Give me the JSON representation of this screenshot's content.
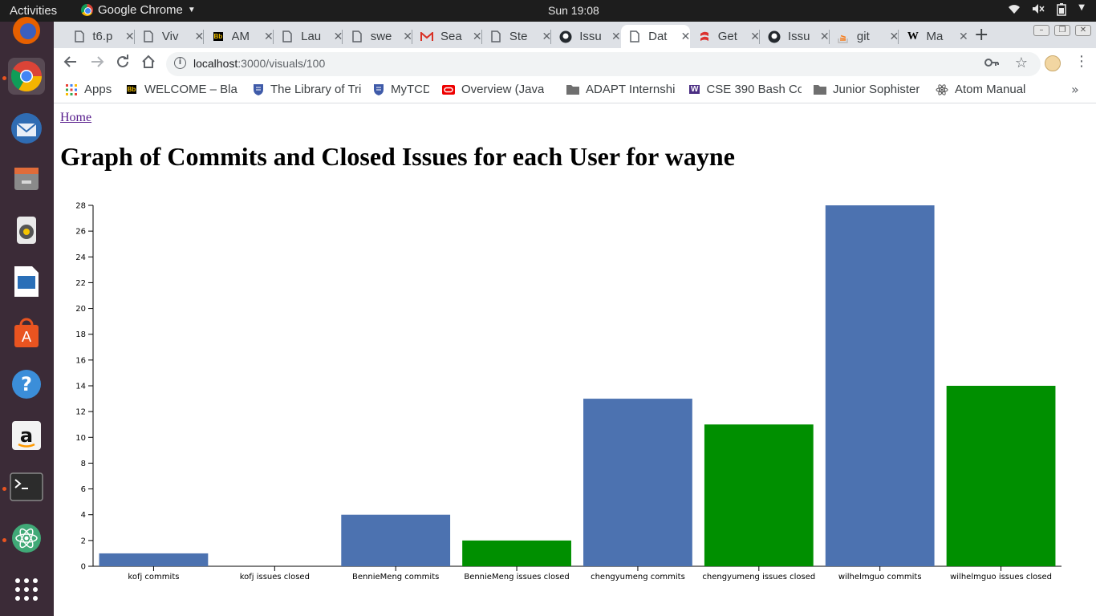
{
  "system_bar": {
    "activities": "Activities",
    "app_name": "Google Chrome",
    "clock": "Sun 19:08"
  },
  "launcher": {
    "apps": [
      "firefox-icon",
      "chrome-icon",
      "thunderbird-icon",
      "files-icon",
      "rhythmbox-icon",
      "libreoffice-writer-icon",
      "software-center-icon",
      "help-icon",
      "amazon-icon",
      "terminal-icon",
      "atom-icon",
      "show-apps-icon"
    ]
  },
  "tabs": [
    {
      "label": "t6.p",
      "icon": "page"
    },
    {
      "label": "Viv",
      "icon": "page"
    },
    {
      "label": "AM",
      "icon": "blackboard"
    },
    {
      "label": "Lau",
      "icon": "page"
    },
    {
      "label": "swe",
      "icon": "page"
    },
    {
      "label": "Sea",
      "icon": "gmail"
    },
    {
      "label": "Ste",
      "icon": "page"
    },
    {
      "label": "Issu",
      "icon": "github"
    },
    {
      "label": "Dat",
      "icon": "page",
      "active": true
    },
    {
      "label": "Get",
      "icon": "scala"
    },
    {
      "label": "Issu",
      "icon": "github"
    },
    {
      "label": "git",
      "icon": "stackoverflow"
    },
    {
      "label": "Ma",
      "icon": "wikipedia"
    }
  ],
  "address_bar": {
    "host": "localhost",
    "path": ":3000/visuals/100"
  },
  "bookmarks": [
    {
      "label": "Apps",
      "icon": "apps"
    },
    {
      "label": "WELCOME – Bla",
      "icon": "blackboard"
    },
    {
      "label": "The Library of Tri",
      "icon": "shield"
    },
    {
      "label": "MyTCD",
      "icon": "shield"
    },
    {
      "label": "Overview (Java",
      "icon": "oracle"
    },
    {
      "label": "ADAPT Internshi",
      "icon": "folder"
    },
    {
      "label": "CSE 390 Bash Co",
      "icon": "washington"
    },
    {
      "label": "Junior Sophister",
      "icon": "folder"
    },
    {
      "label": "Atom Manual",
      "icon": "atom"
    }
  ],
  "page": {
    "home_link": "Home",
    "title": "Graph of Commits and Closed Issues for each User for wayne"
  },
  "colors": {
    "commits": "#4c72b0",
    "issues": "#008f00"
  },
  "chart_data": {
    "type": "bar",
    "categories": [
      "kofj commits",
      "kofj issues closed",
      "BennieMeng commits",
      "BennieMeng issues closed",
      "chengyumeng commits",
      "chengyumeng issues closed",
      "wilhelmguo commits",
      "wilhelmguo issues closed"
    ],
    "values": [
      1,
      0,
      4,
      2,
      13,
      11,
      28,
      14
    ],
    "bar_colors": [
      "#4c72b0",
      "#008f00",
      "#4c72b0",
      "#008f00",
      "#4c72b0",
      "#008f00",
      "#4c72b0",
      "#008f00"
    ],
    "ylim": [
      0,
      28
    ],
    "yticks": [
      0,
      2,
      4,
      6,
      8,
      10,
      12,
      14,
      16,
      18,
      20,
      22,
      24,
      26,
      28
    ],
    "title": "",
    "xlabel": "",
    "ylabel": ""
  }
}
